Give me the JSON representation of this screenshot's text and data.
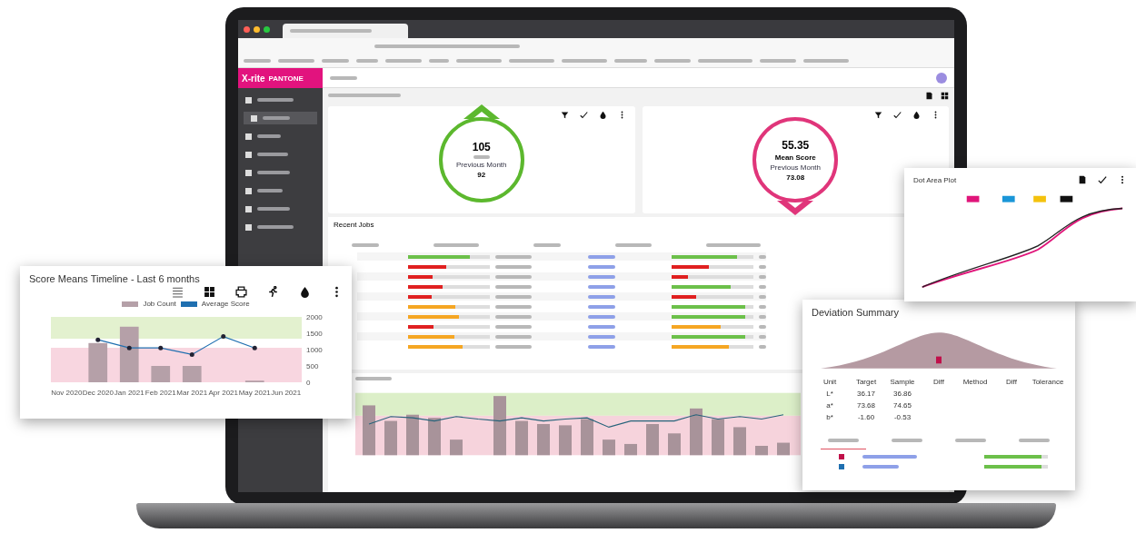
{
  "app": {
    "logo_brand": "X-rite",
    "logo_partner": "PANTONE"
  },
  "sidebar": {
    "items": [
      {
        "selected": false
      },
      {
        "selected": true
      },
      {
        "selected": false
      },
      {
        "selected": false
      },
      {
        "selected": false
      },
      {
        "selected": false
      },
      {
        "selected": false
      },
      {
        "selected": false
      }
    ]
  },
  "kpis": [
    {
      "kind": "up",
      "value": "105",
      "caption": "Previous Month",
      "previous": "92"
    },
    {
      "kind": "down",
      "value": "55.35",
      "label": "Mean Score",
      "caption": "Previous Month",
      "previous": "73.08"
    }
  ],
  "recent_jobs": {
    "title": "Recent Jobs",
    "rows": [
      {
        "bars": [
          {
            "level": 0.75,
            "color": "#6cc04a"
          },
          {
            "level": 0.8,
            "color": "#6cc04a"
          }
        ]
      },
      {
        "bars": [
          {
            "level": 0.47,
            "color": "#e02020"
          },
          {
            "level": 0.45,
            "color": "#e02020"
          }
        ]
      },
      {
        "bars": [
          {
            "level": 0.3,
            "color": "#e02020"
          },
          {
            "level": 0.2,
            "color": "#e02020"
          }
        ]
      },
      {
        "bars": [
          {
            "level": 0.42,
            "color": "#e02020"
          },
          {
            "level": 0.72,
            "color": "#6cc04a"
          }
        ]
      },
      {
        "bars": [
          {
            "level": 0.29,
            "color": "#e02020"
          },
          {
            "level": 0.3,
            "color": "#e02020"
          }
        ]
      },
      {
        "bars": [
          {
            "level": 0.58,
            "color": "#f5a623"
          },
          {
            "level": 0.9,
            "color": "#6cc04a"
          }
        ]
      },
      {
        "bars": [
          {
            "level": 0.62,
            "color": "#f5a623"
          },
          {
            "level": 0.9,
            "color": "#6cc04a"
          }
        ]
      },
      {
        "bars": [
          {
            "level": 0.31,
            "color": "#e02020"
          },
          {
            "level": 0.6,
            "color": "#f5a623"
          }
        ]
      },
      {
        "bars": [
          {
            "level": 0.57,
            "color": "#f5a623"
          },
          {
            "level": 0.9,
            "color": "#6cc04a"
          }
        ]
      },
      {
        "bars": [
          {
            "level": 0.67,
            "color": "#f5a623"
          },
          {
            "level": 0.7,
            "color": "#f5a623"
          }
        ]
      }
    ]
  },
  "timeline_card": {
    "title": "Score Means Timeline - Last 6 months",
    "chart_data": {
      "type": "bar",
      "categories": [
        "Nov 2020",
        "Dec 2020",
        "Jan 2021",
        "Feb 2021",
        "Mar 2021",
        "Apr 2021",
        "May 2021",
        "Jun 2021"
      ],
      "series": [
        {
          "name": "Job Count",
          "color": "#b5a0a8",
          "values": [
            null,
            1200,
            1700,
            500,
            500,
            null,
            50,
            null
          ]
        },
        {
          "name": "Average Score",
          "type": "line",
          "color": "#1f6fb0",
          "values": [
            null,
            1300,
            1050,
            1050,
            850,
            1400,
            1050,
            null
          ]
        }
      ],
      "ylim": [
        0,
        2000
      ],
      "yticks": [
        0,
        500,
        1000,
        1500,
        2000
      ]
    }
  },
  "dot_area_card": {
    "title": "Dot Area Plot"
  },
  "deviation_card": {
    "title": "Deviation Summary",
    "columns": [
      "Unit",
      "Target",
      "Sample",
      "Diff",
      "Method",
      "Diff",
      "Tolerance"
    ],
    "rows": [
      {
        "unit": "L*",
        "target": "36.17",
        "sample": "36.86"
      },
      {
        "unit": "a*",
        "target": "73.68",
        "sample": "74.65"
      },
      {
        "unit": "b*",
        "target": "-1.60",
        "sample": "-0.53"
      }
    ],
    "tabs": [
      {
        "selected": true
      },
      {
        "selected": false
      },
      {
        "selected": false
      },
      {
        "selected": false
      }
    ]
  }
}
